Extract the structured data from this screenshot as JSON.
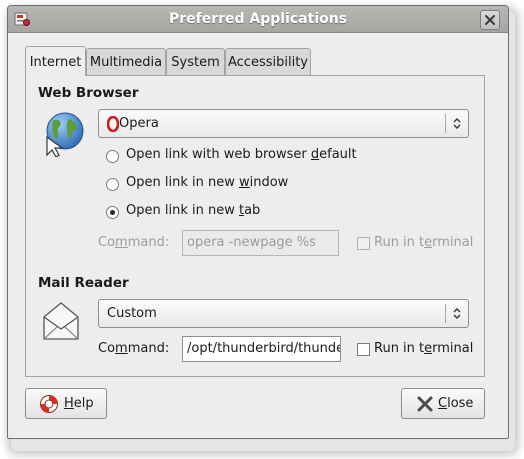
{
  "window": {
    "title": "Preferred Applications"
  },
  "tabs": [
    {
      "label": "Internet",
      "active": true
    },
    {
      "label": "Multimedia",
      "active": false
    },
    {
      "label": "System",
      "active": false
    },
    {
      "label": "Accessibility",
      "active": false
    }
  ],
  "web_browser": {
    "title": "Web Browser",
    "selected": "Opera",
    "options": [
      {
        "prefix": "Open link with web browser ",
        "mnemonic": "d",
        "suffix": "efault",
        "checked": false
      },
      {
        "prefix": "Open link in new ",
        "mnemonic": "w",
        "suffix": "indow",
        "checked": false
      },
      {
        "prefix": "Open link in new ",
        "mnemonic": "t",
        "suffix": "ab",
        "checked": true
      }
    ],
    "command_label_prefix": "Co",
    "command_label_mnemonic": "m",
    "command_label_suffix": "mand:",
    "command_value": "opera -newpage %s",
    "terminal_prefix": "Run in t",
    "terminal_mnemonic": "e",
    "terminal_suffix": "rminal"
  },
  "mail_reader": {
    "title": "Mail Reader",
    "selected": "Custom",
    "command_label_prefix": "Co",
    "command_label_mnemonic": "m",
    "command_label_suffix": "mand:",
    "command_value": "/opt/thunderbird/thunderbird %s",
    "terminal_prefix": "Run in t",
    "terminal_mnemonic": "e",
    "terminal_suffix": "rminal"
  },
  "buttons": {
    "help_mnemonic": "H",
    "help_rest": "elp",
    "close_mnemonic": "C",
    "close_rest": "lose"
  },
  "colors": {
    "titlebar": "#aeacaa",
    "dialog_bg": "#ededed",
    "opera_red": "#cc1b1b"
  },
  "icons": [
    "preferences-icon",
    "window-close-icon",
    "globe-icon",
    "opera-icon",
    "mail-envelope-icon",
    "lifebuoy-icon",
    "close-x-icon"
  ]
}
